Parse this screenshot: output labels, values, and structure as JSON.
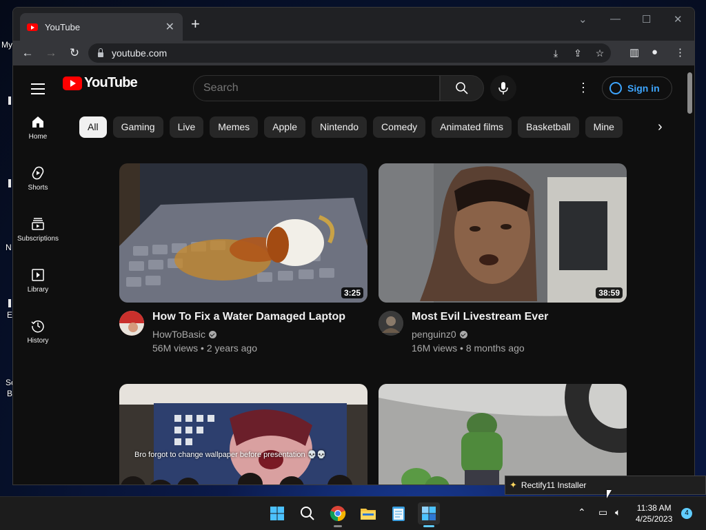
{
  "desktop": {
    "labels": [
      "My",
      "N",
      "E",
      "Sc",
      "B"
    ]
  },
  "browser": {
    "tab_title": "YouTube",
    "tab_close": "✕",
    "new_tab": "+",
    "window_controls": {
      "tabs_menu": "⌄",
      "minimize": "—",
      "maximize": "☐",
      "close": "✕"
    },
    "nav": {
      "back": "←",
      "forward": "→",
      "reload": "↻"
    },
    "url": "youtube.com"
  },
  "youtube": {
    "logo_text": "YouTube",
    "search_placeholder": "Search",
    "sign_in": "Sign in",
    "sidebar": [
      {
        "label": "Home",
        "icon": "home-icon"
      },
      {
        "label": "Shorts",
        "icon": "shorts-icon"
      },
      {
        "label": "Subscriptions",
        "icon": "subscriptions-icon"
      },
      {
        "label": "Library",
        "icon": "library-icon"
      },
      {
        "label": "History",
        "icon": "history-icon"
      }
    ],
    "chips": [
      "All",
      "Gaming",
      "Live",
      "Memes",
      "Apple",
      "Nintendo",
      "Comedy",
      "Animated films",
      "Basketball",
      "Mine"
    ],
    "videos": [
      {
        "title": "How To Fix a Water Damaged Laptop",
        "channel": "HowToBasic",
        "views": "56M views",
        "age": "2 years ago",
        "duration": "3:25"
      },
      {
        "title": "Most Evil Livestream Ever",
        "channel": "penguinz0",
        "views": "16M views",
        "age": "8 months ago",
        "duration": "38:59"
      },
      {
        "caption": "Bro forgot to change wallpaper before presentation 💀💀"
      },
      {}
    ],
    "separator": "•"
  },
  "toast": {
    "text": "Rectify11 Installer"
  },
  "taskbar": {
    "time": "11:38 AM",
    "date": "4/25/2023",
    "notification_count": "4",
    "apps": [
      "start-icon",
      "search-icon",
      "chrome-icon",
      "file-explorer-icon",
      "notepad-icon",
      "rectify11-icon"
    ]
  },
  "colors": {
    "accent": "#3ea6ff",
    "yt_red": "#ff0000",
    "bg": "#0f0f0f"
  }
}
